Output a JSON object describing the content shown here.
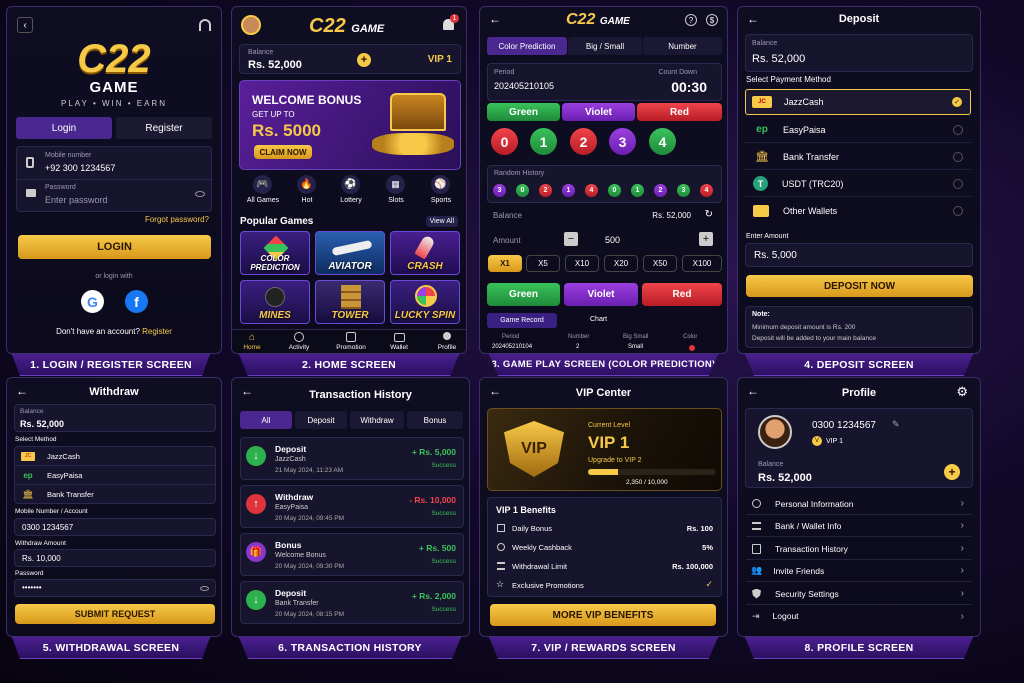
{
  "screens": {
    "login": {
      "caption": "1. LOGIN / REGISTER SCREEN",
      "logo_main": "C22",
      "logo_sub": "GAME",
      "tagline": "PLAY • WIN • EARN",
      "tab_login": "Login",
      "tab_register": "Register",
      "mobile_label": "Mobile number",
      "mobile_value": "+92 300 1234567",
      "password_label": "Password",
      "password_placeholder": "Enter password",
      "forgot": "Forgot password?",
      "login_btn": "LOGIN",
      "or_login": "or login with",
      "no_account": "Don't have an account?",
      "register_link": "Register"
    },
    "home": {
      "caption": "2. HOME SCREEN",
      "logo": "C22",
      "logo_sub": "GAME",
      "notif_count": "1",
      "balance_label": "Balance",
      "balance": "Rs. 52,000",
      "vip": "VIP 1",
      "bonus_title": "WELCOME BONUS",
      "bonus_sub": "GET UP TO",
      "bonus_amount": "Rs. 5000",
      "bonus_cta": "CLAIM NOW",
      "categories": [
        "All Games",
        "Hot",
        "Lottery",
        "Slots",
        "Sports"
      ],
      "popular": "Popular Games",
      "view_all": "View All",
      "games": [
        "COLOR PREDICTION",
        "AVIATOR",
        "CRASH",
        "MINES",
        "TOWER",
        "LUCKY SPIN"
      ],
      "nav": [
        "Home",
        "Activity",
        "Promotion",
        "Wallet",
        "Profile"
      ]
    },
    "game": {
      "caption": "3. GAME PLAY SCREEN (COLOR PREDICTION)",
      "logo": "C22",
      "logo_sub": "GAME",
      "tabs": [
        "Color Prediction",
        "Big / Small",
        "Number"
      ],
      "period_label": "Period",
      "period": "202405210105",
      "countdown_label": "Count Down",
      "countdown": "00:30",
      "colors": [
        "Green",
        "Violet",
        "Red"
      ],
      "numbers": [
        "0",
        "1",
        "2",
        "3",
        "4"
      ],
      "history_label": "Random History",
      "history": [
        "3",
        "0",
        "2",
        "1",
        "4",
        "0",
        "1",
        "2",
        "3",
        "4"
      ],
      "balance_label": "Balance",
      "balance": "Rs. 52,000",
      "amount_label": "Amount",
      "amount": "500",
      "multipliers": [
        "X1",
        "X5",
        "X10",
        "X20",
        "X50",
        "X100"
      ],
      "record_tabs": [
        "Game Record",
        "Chart"
      ],
      "record_headers": [
        "Period",
        "Number",
        "Big Small",
        "Color"
      ],
      "record_row": [
        "202405210104",
        "2",
        "Small",
        ""
      ]
    },
    "deposit": {
      "caption": "4. DEPOSIT SCREEN",
      "title": "Deposit",
      "balance_label": "Balance",
      "balance": "Rs. 52,000",
      "method_label": "Select Payment Method",
      "methods": [
        "JazzCash",
        "EasyPaisa",
        "Bank Transfer",
        "USDT (TRC20)",
        "Other Wallets"
      ],
      "amount_label": "Enter Amount",
      "amount": "Rs. 5,000",
      "cta": "DEPOSIT NOW",
      "note_title": "Note:",
      "note_1": "Minimum deposit amount is Rs. 200",
      "note_2": "Deposit will be added to your main balance"
    },
    "withdraw": {
      "caption": "5. WITHDRAWAL SCREEN",
      "title": "Withdraw",
      "balance_label": "Balance",
      "balance": "Rs. 52,000",
      "method_label": "Select Method",
      "methods": [
        "JazzCash",
        "EasyPaisa",
        "Bank Transfer"
      ],
      "account_label": "Mobile Number / Account",
      "account": "0300 1234567",
      "amount_label": "Withdraw Amount",
      "amount": "Rs. 10,000",
      "password_label": "Password",
      "password": "•••••••",
      "cta": "SUBMIT REQUEST"
    },
    "history": {
      "caption": "6. TRANSACTION HISTORY",
      "title": "Transaction History",
      "tabs": [
        "All",
        "Deposit",
        "Withdraw",
        "Bonus"
      ],
      "items": [
        {
          "type": "Deposit",
          "sub": "JazzCash",
          "date": "21 May 2024, 11:23 AM",
          "amount": "+ Rs. 5,000",
          "status": "Success"
        },
        {
          "type": "Withdraw",
          "sub": "EasyPaisa",
          "date": "20 May 2024, 09:45 PM",
          "amount": "- Rs. 10,000",
          "status": "Success"
        },
        {
          "type": "Bonus",
          "sub": "Welcome Bonus",
          "date": "20 May 2024, 09:30 PM",
          "amount": "+ Rs. 500",
          "status": "Success"
        },
        {
          "type": "Deposit",
          "sub": "Bank Transfer",
          "date": "20 May 2024, 08:15 PM",
          "amount": "+ Rs. 2,000",
          "status": "Success"
        }
      ]
    },
    "vip": {
      "caption": "7. VIP / REWARDS SCREEN",
      "title": "VIP Center",
      "badge": "VIP",
      "current_label": "Current Level",
      "level": "VIP 1",
      "upgrade": "Upgrade to VIP 2",
      "progress_text": "2,350 / 10,000",
      "progress": 0.235,
      "benefits_title": "VIP 1 Benefits",
      "benefits": [
        {
          "label": "Daily Bonus",
          "value": "Rs. 100"
        },
        {
          "label": "Weekly Cashback",
          "value": "5%"
        },
        {
          "label": "Withdrawal Limit",
          "value": "Rs. 100,000"
        },
        {
          "label": "Exclusive Promotions",
          "value": "✓"
        }
      ],
      "cta": "MORE VIP BENEFITS"
    },
    "profile": {
      "caption": "8. PROFILE SCREEN",
      "title": "Profile",
      "phone": "0300 1234567",
      "vip": "VIP 1",
      "balance_label": "Balance",
      "balance": "Rs. 52,000",
      "menu": [
        "Personal Information",
        "Bank / Wallet Info",
        "Transaction History",
        "Invite Friends",
        "Security Settings",
        "Logout"
      ]
    }
  },
  "colors": {
    "gold": "#f7c948",
    "green": "#2fb04e",
    "violet": "#8a35d0",
    "red": "#e0343c",
    "accent": "#6a3fc0"
  }
}
